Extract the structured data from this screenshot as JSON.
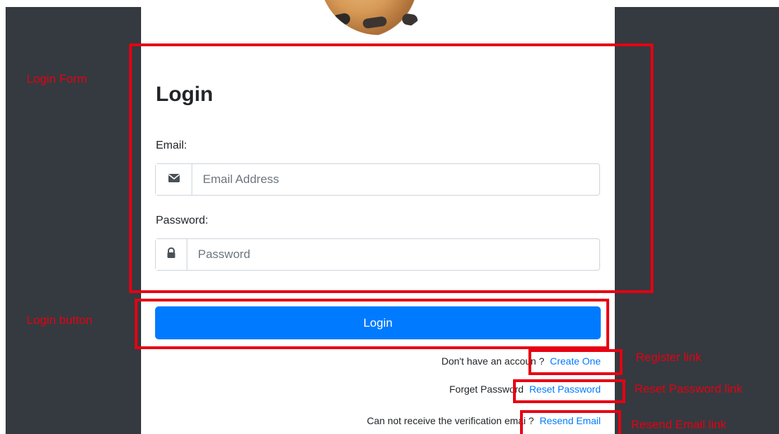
{
  "login": {
    "title": "Login",
    "email_label": "Email:",
    "email_placeholder": "Email Address",
    "password_label": "Password:",
    "password_placeholder": "Password",
    "button_label": "Login"
  },
  "links": {
    "register": {
      "prefix": "Don't have an accoun ?",
      "label": "Create One"
    },
    "reset": {
      "prefix": "Forget Password",
      "label": "Reset Password"
    },
    "resend": {
      "prefix": "Can not receive the verification emai ?",
      "label": "Resend Email"
    }
  },
  "annotations": {
    "form": "Login Form",
    "button": "Login button",
    "register": "Register link",
    "reset": "Reset Password link",
    "resend": "Resend Email link"
  },
  "icons": {
    "email": "envelope-icon",
    "password": "lock-icon"
  },
  "colors": {
    "sidebar": "#343a40",
    "primary": "#007bff",
    "annotation": "#e60012"
  }
}
